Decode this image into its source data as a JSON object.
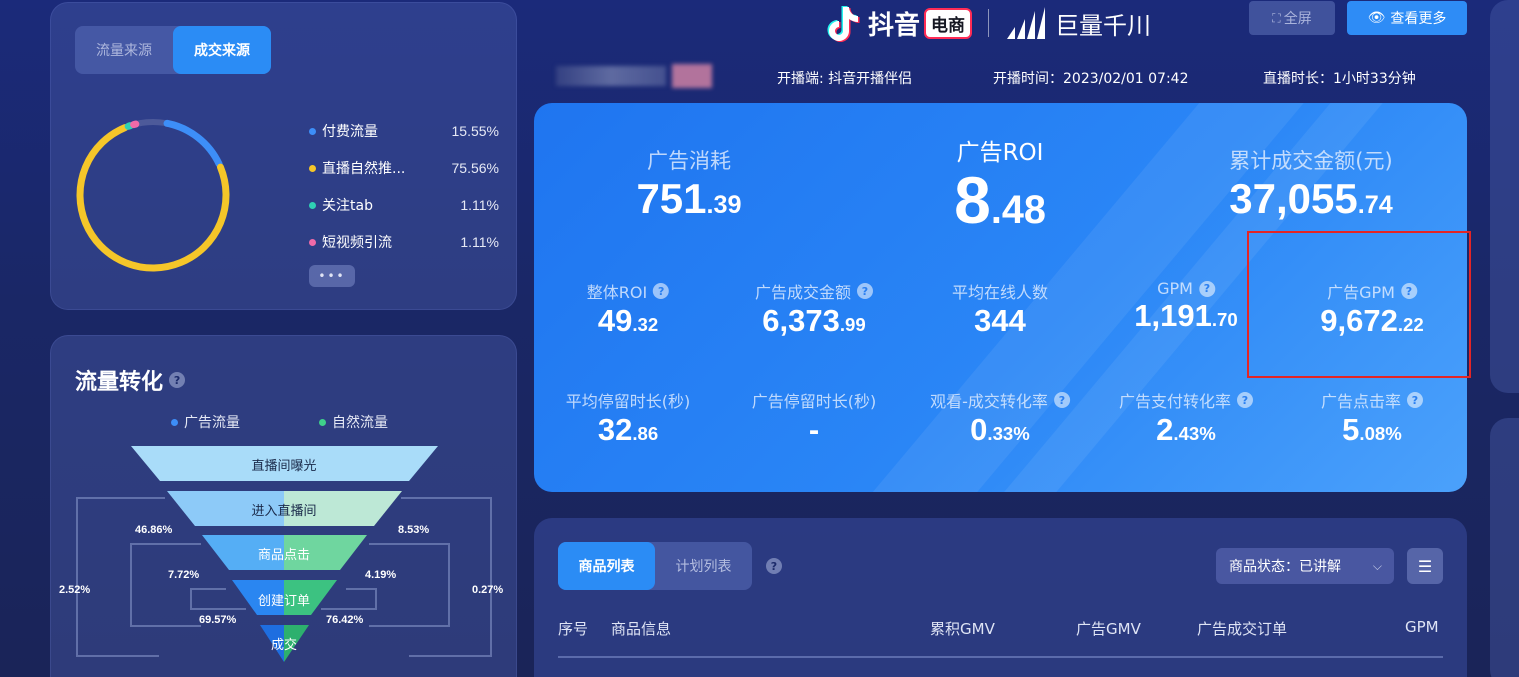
{
  "source_card": {
    "tabs": [
      {
        "label": "流量来源",
        "active": false
      },
      {
        "label": "成交来源",
        "active": true
      }
    ],
    "legend": [
      {
        "name": "付费流量",
        "pct": "15.55%",
        "color": "#3d8ef8"
      },
      {
        "name": "直播自然推...",
        "pct": "75.56%",
        "color": "#f5c629"
      },
      {
        "name": "关注tab",
        "pct": "1.11%",
        "color": "#2fd0b4"
      },
      {
        "name": "短视频引流",
        "pct": "1.11%",
        "color": "#f06aa8"
      }
    ],
    "more_label": "•••"
  },
  "funnel_card": {
    "title": "流量转化",
    "help": "?",
    "legend": [
      {
        "name": "广告流量",
        "color": "#3d8ef8"
      },
      {
        "name": "自然流量",
        "color": "#3fd08a"
      }
    ],
    "stages": [
      "直播间曝光",
      "进入直播间",
      "商品点击",
      "创建订单",
      "成交"
    ],
    "left_pcts": [
      "46.86%",
      "7.72%",
      "69.57%"
    ],
    "right_pcts": [
      "8.53%",
      "4.19%",
      "76.42%"
    ],
    "outer_left": "2.52%",
    "outer_right": "0.27%"
  },
  "header": {
    "douyin": "抖音",
    "dianshang": "电商",
    "juliang": "巨量千川",
    "fullscreen": "全屏",
    "view_more": "查看更多",
    "platform": "开播端: 抖音开播伴侣",
    "start_time": "开播时间：2023/02/01 07:42",
    "duration": "直播时长：1小时33分钟"
  },
  "stats": {
    "ad_spend": {
      "label": "广告消耗",
      "int": "751",
      "dec": ".39"
    },
    "ad_roi": {
      "label": "广告ROI",
      "int": "8",
      "dec": ".48"
    },
    "total_gmv": {
      "label": "累计成交金额(元)",
      "int": "37,055",
      "dec": ".74"
    },
    "overall_roi": {
      "label": "整体ROI",
      "int": "49",
      "dec": ".32"
    },
    "ad_gmv": {
      "label": "广告成交金额",
      "int": "6,373",
      "dec": ".99"
    },
    "avg_online": {
      "label": "平均在线人数",
      "int": "344",
      "dec": ""
    },
    "gpm": {
      "label": "GPM",
      "int": "1,191",
      "dec": ".70"
    },
    "ad_gpm": {
      "label": "广告GPM",
      "int": "9,672",
      "dec": ".22"
    },
    "avg_stay": {
      "label": "平均停留时长(秒)",
      "int": "32",
      "dec": ".86"
    },
    "ad_stay": {
      "label": "广告停留时长(秒)",
      "int": "-",
      "dec": ""
    },
    "view_conv": {
      "label": "观看-成交转化率",
      "int": "0",
      "dec": ".33%"
    },
    "ad_pay_conv": {
      "label": "广告支付转化率",
      "int": "2",
      "dec": ".43%"
    },
    "ad_ctr": {
      "label": "广告点击率",
      "int": "5",
      "dec": ".08%"
    }
  },
  "products": {
    "tabs": [
      {
        "label": "商品列表",
        "active": true
      },
      {
        "label": "计划列表",
        "active": false
      }
    ],
    "status_filter": "商品状态：已讲解",
    "columns": [
      "序号",
      "商品信息",
      "累积GMV",
      "广告GMV",
      "广告成交订单",
      "GPM"
    ]
  }
}
